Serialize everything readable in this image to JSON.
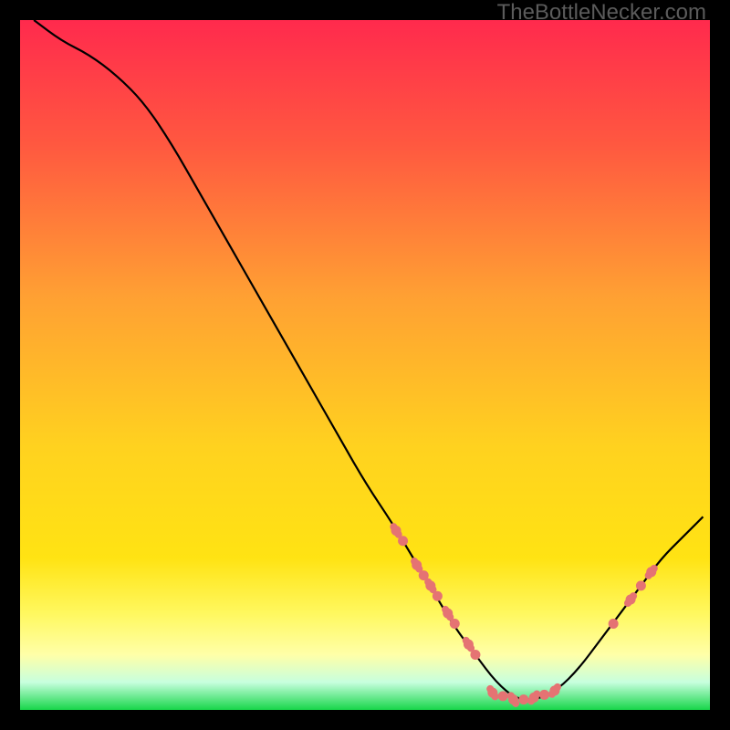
{
  "watermark": "TheBottleNecker.com",
  "chart_data": {
    "type": "line",
    "title": "",
    "xlabel": "",
    "ylabel": "",
    "xlim": [
      0,
      100
    ],
    "ylim": [
      0,
      100
    ],
    "grid": false,
    "gradient": {
      "top": "#ff2a4d",
      "mid_upper": "#ffb030",
      "mid": "#ffe313",
      "lower_band": "#ffff6b",
      "bottom": "#17d64a"
    },
    "curve": {
      "comment": "Approximate V-shaped bottleneck curve. y is percent (0=bottom/green, 100=top/red). Minimum near x≈72.",
      "x": [
        2,
        6,
        10,
        14,
        18,
        22,
        26,
        30,
        34,
        38,
        42,
        46,
        50,
        54,
        57,
        60,
        63,
        66,
        69,
        72,
        75,
        78,
        81,
        84,
        87,
        90,
        93,
        96,
        99
      ],
      "y": [
        100,
        97,
        95,
        92,
        88,
        82,
        75,
        68,
        61,
        54,
        47,
        40,
        33,
        27,
        22,
        17,
        12,
        8,
        4,
        1.5,
        1.5,
        3,
        6,
        10,
        14,
        18,
        22,
        25,
        28
      ]
    },
    "markers": {
      "comment": "Salmon/pink dot+dash markers scattered along the lower part of the curve.",
      "color": "#e57373",
      "points": [
        {
          "x": 54.5,
          "y": 26
        },
        {
          "x": 55.5,
          "y": 24.5
        },
        {
          "x": 57.5,
          "y": 21
        },
        {
          "x": 58.5,
          "y": 19.5
        },
        {
          "x": 59.5,
          "y": 18
        },
        {
          "x": 60.5,
          "y": 16.5
        },
        {
          "x": 62,
          "y": 14
        },
        {
          "x": 63,
          "y": 12.5
        },
        {
          "x": 65,
          "y": 9.5
        },
        {
          "x": 66,
          "y": 8
        },
        {
          "x": 68.5,
          "y": 2.5
        },
        {
          "x": 70,
          "y": 2
        },
        {
          "x": 71.5,
          "y": 1.5
        },
        {
          "x": 73,
          "y": 1.5
        },
        {
          "x": 74.5,
          "y": 1.8
        },
        {
          "x": 76,
          "y": 2.2
        },
        {
          "x": 77.5,
          "y": 2.8
        },
        {
          "x": 86,
          "y": 12.5
        },
        {
          "x": 88.5,
          "y": 16
        },
        {
          "x": 90,
          "y": 18
        },
        {
          "x": 91.5,
          "y": 20
        }
      ]
    }
  }
}
